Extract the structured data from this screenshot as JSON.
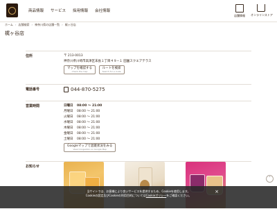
{
  "header": {
    "nav": [
      "商品情報",
      "サービス",
      "採用情報",
      "会社情報"
    ],
    "store_info_label": "店舗情報",
    "online_store_label": "オンラインストア"
  },
  "breadcrumb": [
    "ホーム",
    "店舗検索",
    "神奈川県の店舗一覧",
    "梶ヶ谷店"
  ],
  "title": "梶ヶ谷店",
  "address": {
    "label": "住所",
    "postal": "〒 213-0013",
    "line": "神奈川県川崎市高津区末長１丁目４９−１ 田園スクエアテラス",
    "map_button": "マップを確認する",
    "map_button_sub": "Check the map",
    "route_button": "ルートを検索",
    "route_button_sub": "Search for a route"
  },
  "phone": {
    "label": "電話番号",
    "number": "044-870-5275"
  },
  "hours": {
    "label": "営業時間",
    "rows": [
      {
        "day": "日曜日",
        "time": "08:00 ～ 21:00"
      },
      {
        "day": "月曜日",
        "time": "08:00 ～ 21:00"
      },
      {
        "day": "火曜日",
        "time": "08:00 ～ 21:00"
      },
      {
        "day": "水曜日",
        "time": "08:00 ～ 21:00"
      },
      {
        "day": "木曜日",
        "time": "08:00 ～ 21:00"
      },
      {
        "day": "金曜日",
        "time": "08:00 ～ 21:00"
      },
      {
        "day": "土曜日",
        "time": "08:00 ～ 21:00"
      }
    ],
    "google_button": "Googleマップで混雑状況をみる",
    "google_button_sub": "View Congestion on Google Map"
  },
  "news": {
    "label": "お知らせ"
  },
  "cookie": {
    "line1_a": "当サイトでは、お客様により良いサービスを提供するため、Cookieを使用します。",
    "line2_a": "Cookieの設定及びCookieの利用目的については",
    "line2_link": "Cookieポリシー",
    "line2_b": "をご確認ください。",
    "close": "×"
  }
}
